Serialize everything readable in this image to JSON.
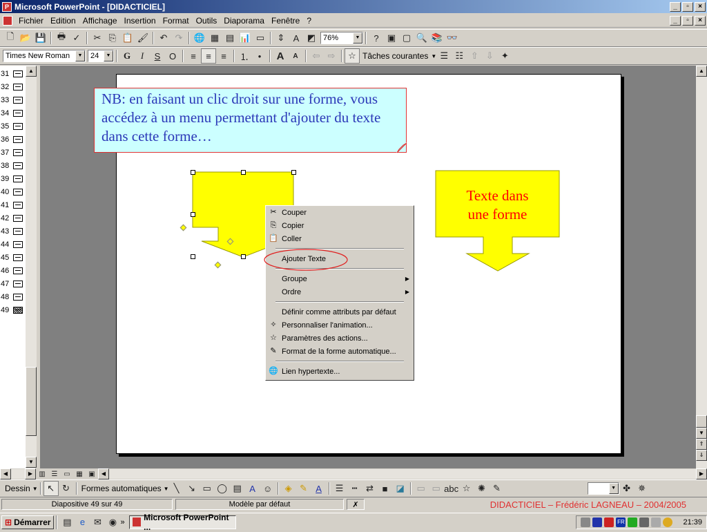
{
  "window": {
    "title": "Microsoft PowerPoint - [DIDACTICIEL]"
  },
  "menu": [
    "Fichier",
    "Edition",
    "Affichage",
    "Insertion",
    "Format",
    "Outils",
    "Diaporama",
    "Fenêtre",
    "?"
  ],
  "toolbar1": {
    "zoom": "76%"
  },
  "toolbar2": {
    "font": "Times New Roman",
    "size": "24",
    "bold": "G",
    "italic": "I",
    "underline": "S",
    "shadow": "O",
    "tasks": "Tâches courantes"
  },
  "outline": {
    "rows": [
      "31",
      "32",
      "33",
      "34",
      "35",
      "36",
      "37",
      "38",
      "39",
      "40",
      "41",
      "42",
      "43",
      "44",
      "45",
      "46",
      "47",
      "48",
      "49"
    ]
  },
  "slide": {
    "note": "NB: en faisant un clic droit sur une forme, vous accédez à un menu permettant d'ajouter du texte dans cette forme…",
    "shape_text_line1": "Texte dans",
    "shape_text_line2": "une forme"
  },
  "context_menu": {
    "cut": "Couper",
    "copy": "Copier",
    "paste": "Coller",
    "add_text": "Ajouter Texte",
    "group": "Groupe",
    "order": "Ordre",
    "set_default": "Définir comme attributs par défaut",
    "custom_anim": "Personnaliser l'animation...",
    "action_settings": "Paramètres des actions...",
    "autoshape_format": "Format de la forme automatique...",
    "hyperlink": "Lien hypertexte..."
  },
  "drawing": {
    "draw": "Dessin",
    "autoshapes": "Formes automatiques"
  },
  "status": {
    "slide": "Diapositive 49 sur 49",
    "template": "Modèle par défaut",
    "credit": "DIDACTICIEL – Frédéric LAGNEAU – 2004/2005"
  },
  "taskbar": {
    "start": "Démarrer",
    "app": "Microsoft PowerPoint ...",
    "clock": "21:39"
  },
  "colors": {
    "shape_yellow": "#ffff00",
    "note_bg": "#ccffff",
    "note_text": "#2b38b8",
    "shape_text": "#ff0000",
    "credit": "#e03030"
  }
}
